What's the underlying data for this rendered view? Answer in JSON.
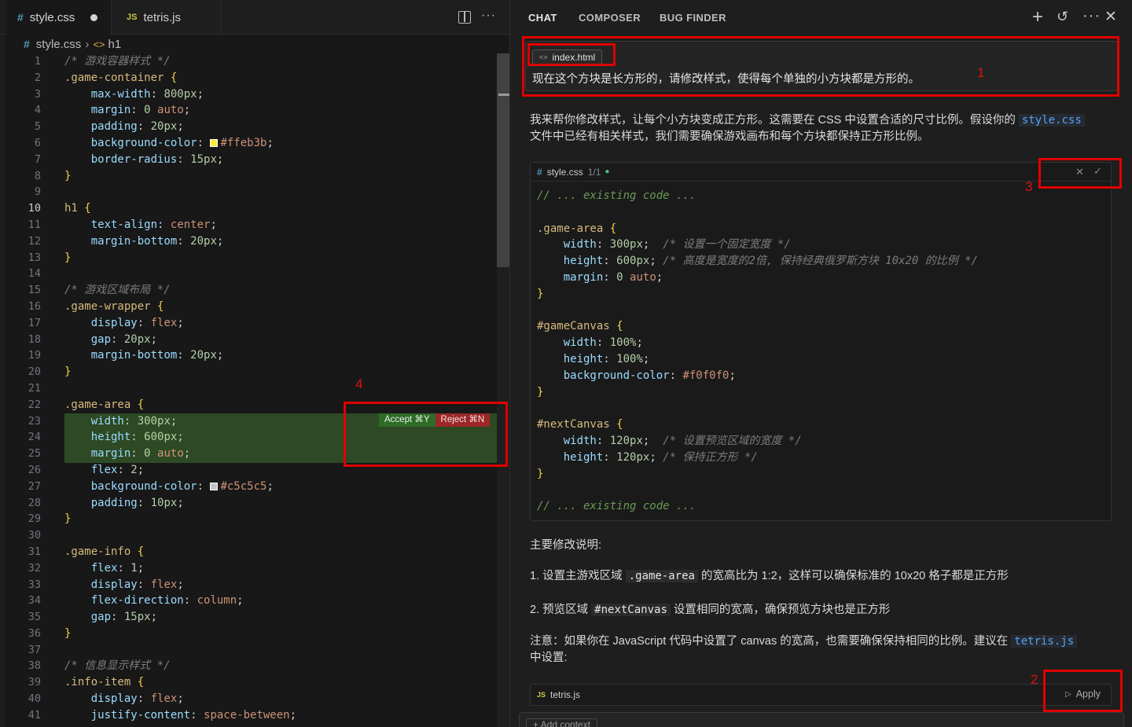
{
  "editor": {
    "tabs": [
      {
        "label": "style.css",
        "modified": true
      },
      {
        "label": "tetris.js"
      }
    ],
    "breadcrumb": {
      "file": "style.css",
      "symbol": "h1"
    },
    "active_line": 10,
    "diff_actions": {
      "accept": "Accept ⌘Y",
      "reject": "Reject ⌘N"
    },
    "colors": {
      "diff_added_bg": "#2d4a24",
      "accept": "#2e6b27",
      "reject": "#9c2727"
    }
  },
  "chat": {
    "tabs": [
      "CHAT",
      "COMPOSER",
      "BUG FINDER"
    ],
    "user_message": {
      "context_file": "index.html",
      "text": "现在这个方块是长方形的，请修改样式，使得每个单独的小方块都是方形的。"
    },
    "reply": {
      "intro_1": "我来帮你修改样式，让每个小方块变成正方形。这需要在 CSS 中设置合适的尺寸比例。假设你的",
      "intro_file": "style.css",
      "intro_2": "文件中已经有相关样式，我们需要确保游戏画布和每个方块都保持正方形比例。",
      "code_block": {
        "file": "style.css",
        "counter": "1/1"
      },
      "summary_title": "主要修改说明:",
      "point1_a": "1. 设置主游戏区域",
      "point1_code": ".game-area",
      "point1_b": "的宽高比为 1:2，这样可以确保标准的 10x20 格子都是正方形",
      "point2_a": "2. 预览区域",
      "point2_code": "#nextCanvas",
      "point2_b": "设置相同的宽高，确保预览方块也是正方形",
      "note_a": "注意：如果你在 JavaScript 代码中设置了 canvas 的宽高，也需要确保保持相同的比例。建议在",
      "note_file": "tetris.js",
      "note_b": "中设置:",
      "apply_block": {
        "file": "tetris.js",
        "apply_label": "Apply"
      }
    },
    "composer": {
      "add_context": "+ Add context"
    }
  },
  "annotations": [
    "1",
    "2",
    "3",
    "4"
  ]
}
